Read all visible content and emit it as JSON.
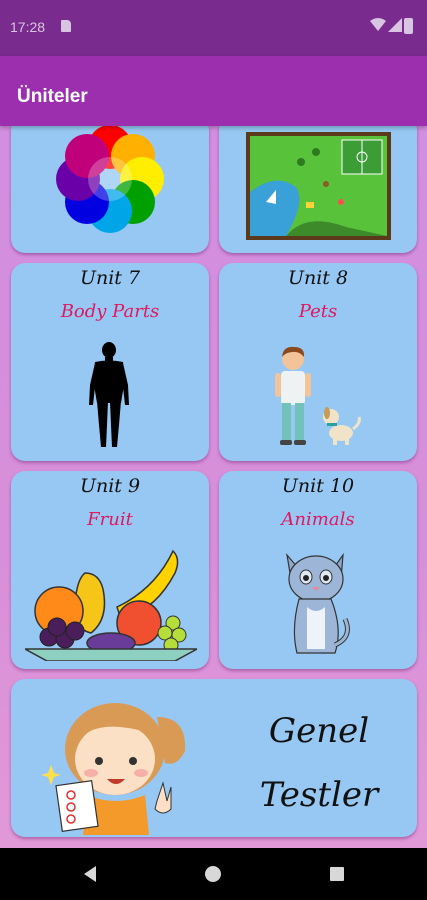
{
  "status_bar": {
    "time": "17:28"
  },
  "app_bar": {
    "title": "Üniteler"
  },
  "cards": [
    {
      "unit": "Unit 7",
      "topic": "Body Parts"
    },
    {
      "unit": "Unit 8",
      "topic": "Pets"
    },
    {
      "unit": "Unit 9",
      "topic": "Fruit"
    },
    {
      "unit": "Unit 10",
      "topic": "Animals"
    }
  ],
  "general_tests": {
    "line1": "Genel",
    "line2": "Testler"
  },
  "icons": {
    "colors_card": "color-flower-icon",
    "map_card": "map-picture-icon",
    "body_parts": "human-silhouette-icon",
    "pets": "boy-with-dog-icon",
    "fruit": "fruit-bowl-icon",
    "animals": "cat-icon",
    "tests": "girl-with-test-paper-icon"
  }
}
